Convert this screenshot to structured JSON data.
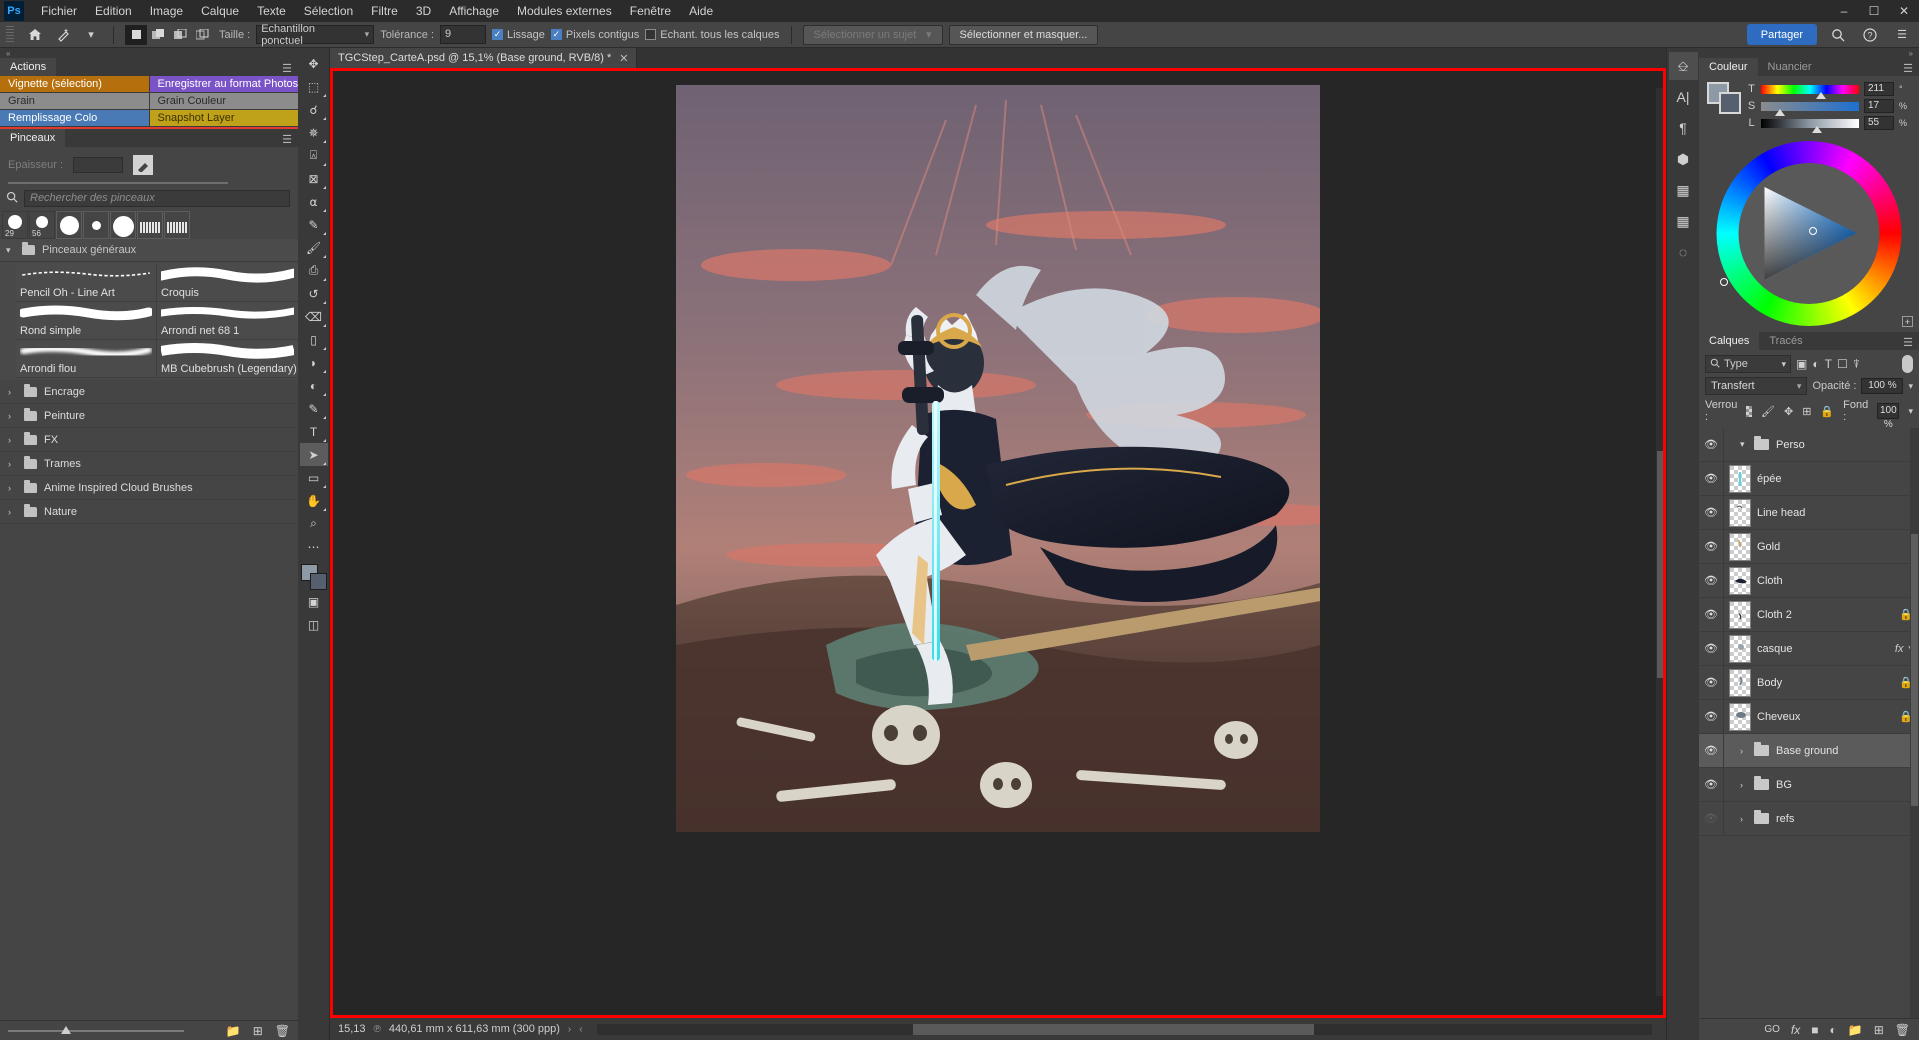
{
  "menubar": {
    "logo": "Ps",
    "items": [
      "Fichier",
      "Edition",
      "Image",
      "Calque",
      "Texte",
      "Sélection",
      "Filtre",
      "3D",
      "Affichage",
      "Modules externes",
      "Fenêtre",
      "Aide"
    ],
    "window_controls": [
      "minimize",
      "maximize",
      "close"
    ]
  },
  "options_bar": {
    "home_icon": "home-icon",
    "tool_icon": "magic-wand-icon",
    "selection_modes": [
      "new-selection",
      "add-to-selection",
      "subtract-from-selection",
      "intersect-selection"
    ],
    "size_label": "Taille :",
    "size_value": "Echantillon ponctuel",
    "tolerance_label": "Tolérance :",
    "tolerance_value": "9",
    "smoothing_label": "Lissage",
    "smoothing_checked": true,
    "contiguous_label": "Pixels contigus",
    "contiguous_checked": true,
    "all_layers_label": "Echant. tous les calques",
    "all_layers_checked": false,
    "select_subject_label": "Sélectionner un sujet",
    "select_mask_label": "Sélectionner et masquer...",
    "share_label": "Partager",
    "search_icon": "search-icon",
    "help_icon": "help-icon",
    "grid_icon": "grid-icon",
    "accent_color": "#2d6cc0"
  },
  "left_dock": {
    "actions_panel": {
      "tab_label": "Actions",
      "tab_inactive": "",
      "buttons": [
        [
          {
            "label": "Vignette (sélection)",
            "color": "#b5700d",
            "text_color": "#ffffff"
          },
          {
            "label": "Enregistrer au format Photos...",
            "color": "#7a54c6",
            "text_color": "#ffffff"
          }
        ],
        [
          {
            "label": "Grain",
            "color": "#8c8c8c",
            "text_color": "#2b2b2b"
          },
          {
            "label": "Grain Couleur",
            "color": "#8c8c8c",
            "text_color": "#2b2b2b"
          }
        ],
        [
          {
            "label": "Remplissage Colo",
            "color": "#4a7ab5",
            "text_color": "#ffffff"
          },
          {
            "label": "Snapshot Layer",
            "color": "#c0a21a",
            "text_color": "#3a3000"
          }
        ]
      ],
      "divider_color": "#e03a32"
    },
    "brushes_panel": {
      "tab_label": "Pinceaux",
      "thickness_label": "Epaisseur :",
      "thickness_value": "",
      "search_placeholder": "Rechercher des pinceaux",
      "presets": [
        {
          "name": "29",
          "size": 14
        },
        {
          "name": "56",
          "size": 12
        },
        {
          "name": "",
          "size": 20
        },
        {
          "name": "",
          "size": 9
        },
        {
          "name": "",
          "size": 21
        },
        {
          "name": "",
          "size": 0
        },
        {
          "name": "",
          "size": 0
        }
      ],
      "group_label": "Pinceaux généraux",
      "brushes": [
        {
          "label": "Pencil Oh - Line Art",
          "style": "pencil"
        },
        {
          "label": "Croquis",
          "style": "thick"
        },
        {
          "label": "Rond simple",
          "style": "round"
        },
        {
          "label": "Arrondi net 68 1",
          "style": "thin"
        },
        {
          "label": "Arrondi flou",
          "style": "soft"
        },
        {
          "label": "MB Cubebrush (Legendary)",
          "style": "thick"
        }
      ],
      "folders": [
        "Encrage",
        "Peinture",
        "FX",
        "Trames",
        "Anime Inspired Cloud Brushes",
        "Nature"
      ],
      "footer_icons": [
        "new-folder-icon",
        "new-brush-icon",
        "delete-icon"
      ]
    }
  },
  "toolbar": {
    "tools": [
      {
        "name": "move-tool",
        "glyph": "✥",
        "selected": false
      },
      {
        "name": "marquee-tool",
        "glyph": "⬚",
        "selected": false
      },
      {
        "name": "lasso-tool",
        "glyph": "◠",
        "selected": false
      },
      {
        "name": "magic-wand-tool",
        "glyph": "✧",
        "selected": false
      },
      {
        "name": "crop-tool",
        "glyph": "⌗",
        "selected": false
      },
      {
        "name": "frame-tool",
        "glyph": "⊠",
        "selected": false
      },
      {
        "name": "eyedropper-tool",
        "glyph": "⌁",
        "selected": false
      },
      {
        "name": "healing-brush-tool",
        "glyph": "✎",
        "selected": false
      },
      {
        "name": "brush-tool",
        "glyph": "🖌",
        "selected": false
      },
      {
        "name": "clone-stamp-tool",
        "glyph": "⎙",
        "selected": false
      },
      {
        "name": "history-brush-tool",
        "glyph": "↺",
        "selected": false
      },
      {
        "name": "eraser-tool",
        "glyph": "⌫",
        "selected": false
      },
      {
        "name": "gradient-tool",
        "glyph": "▭",
        "selected": false
      },
      {
        "name": "blur-tool",
        "glyph": "◗",
        "selected": false
      },
      {
        "name": "dodge-tool",
        "glyph": "◐",
        "selected": false
      },
      {
        "name": "pen-tool",
        "glyph": "✒",
        "selected": false
      },
      {
        "name": "type-tool",
        "glyph": "T",
        "selected": false
      },
      {
        "name": "path-selection-tool",
        "glyph": "➤",
        "selected": true
      },
      {
        "name": "rectangle-tool",
        "glyph": "▭",
        "selected": false
      },
      {
        "name": "hand-tool",
        "glyph": "✋",
        "selected": false
      },
      {
        "name": "zoom-tool",
        "glyph": "⌕",
        "selected": false
      },
      {
        "name": "more-tools",
        "glyph": "•••",
        "selected": false
      }
    ],
    "foreground_color": "#8e99a6",
    "background_color": "#555f6d",
    "quick_mask_icon": "quick-mask-icon",
    "screen_mode_icon": "screen-mode-icon"
  },
  "document": {
    "tab_title": "TGCStep_CarteA.psd @ 15,1% (Base ground, RVB/8) *",
    "close_glyph": "✕",
    "selection_border_color": "#ff0000"
  },
  "statusbar": {
    "zoom": "15,13",
    "zoom_unit": "%",
    "doc_size": "440,61 mm x 611,63 mm (300 ppp)",
    "arrow_right": "›",
    "arrow_left": "‹"
  },
  "icon_rail": {
    "buttons": [
      {
        "name": "properties-icon",
        "glyph": "⌸",
        "active": true
      },
      {
        "name": "character-icon",
        "glyph": "A",
        "active": false
      },
      {
        "name": "paragraph-icon",
        "glyph": "¶",
        "active": false
      },
      {
        "name": "3d-icon",
        "glyph": "⬡",
        "active": false
      },
      {
        "name": "library-icon",
        "glyph": "▤",
        "active": false
      },
      {
        "name": "histogram-icon",
        "glyph": "▦",
        "active": false
      },
      {
        "name": "adjustments-icon",
        "glyph": "◍",
        "active": false
      }
    ]
  },
  "right_dock": {
    "color_panel": {
      "tabs": [
        {
          "label": "Couleur",
          "active": true
        },
        {
          "label": "Nuancier",
          "active": false
        }
      ],
      "menu_icon": "panel-menu-icon",
      "foreground_color": "#8e99a6",
      "background_color": "#555f6d",
      "sliders": [
        {
          "label": "T",
          "value": "211",
          "unit": "°",
          "pos": 60
        },
        {
          "label": "S",
          "value": "17",
          "unit": "%",
          "pos": 17
        },
        {
          "label": "L",
          "value": "55",
          "unit": "%",
          "pos": 55
        }
      ],
      "add_swatch_icon": "add-swatch-icon"
    },
    "layers_panel": {
      "tabs": [
        {
          "label": "Calques",
          "active": true
        },
        {
          "label": "Tracés",
          "active": false
        }
      ],
      "menu_icon": "panel-menu-icon",
      "filter_label": "Type",
      "filter_icons": [
        "pixel-filter-icon",
        "adjustment-filter-icon",
        "type-filter-icon",
        "shape-filter-icon",
        "smart-object-filter-icon"
      ],
      "blend_mode": "Transfert",
      "opacity_label": "Opacité :",
      "opacity_value": "100 %",
      "lock_label": "Verrou :",
      "lock_icons": [
        "lock-transparent-icon",
        "lock-image-icon",
        "lock-position-icon",
        "lock-artboard-icon",
        "lock-all-icon"
      ],
      "fill_label": "Fond :",
      "fill_value": "100 %",
      "layers": [
        {
          "name": "Perso",
          "type": "group",
          "expanded": true,
          "visible": true,
          "locked": false,
          "fx": false,
          "selected": false
        },
        {
          "name": "épée",
          "type": "layer",
          "visible": true,
          "locked": false,
          "fx": false,
          "selected": false
        },
        {
          "name": "Line head",
          "type": "layer",
          "visible": true,
          "locked": false,
          "fx": false,
          "selected": false
        },
        {
          "name": "Gold",
          "type": "layer",
          "visible": true,
          "locked": false,
          "fx": false,
          "selected": false
        },
        {
          "name": "Cloth",
          "type": "layer",
          "visible": true,
          "locked": false,
          "fx": false,
          "selected": false
        },
        {
          "name": "Cloth 2",
          "type": "layer",
          "visible": true,
          "locked": true,
          "fx": false,
          "selected": false
        },
        {
          "name": "casque",
          "type": "layer",
          "visible": true,
          "locked": false,
          "fx": true,
          "selected": false
        },
        {
          "name": "Body",
          "type": "layer",
          "visible": true,
          "locked": true,
          "fx": false,
          "selected": false
        },
        {
          "name": "Cheveux",
          "type": "layer",
          "visible": true,
          "locked": true,
          "fx": false,
          "selected": false
        },
        {
          "name": "Base ground",
          "type": "group",
          "expanded": false,
          "visible": true,
          "locked": false,
          "fx": false,
          "selected": true
        },
        {
          "name": "BG",
          "type": "group",
          "expanded": false,
          "visible": true,
          "locked": false,
          "fx": false,
          "selected": false
        },
        {
          "name": "refs",
          "type": "group",
          "expanded": false,
          "visible": false,
          "locked": false,
          "fx": false,
          "selected": false
        }
      ],
      "footer_icons": [
        "link-layers-icon",
        "layer-style-icon",
        "layer-mask-icon",
        "adjustment-layer-icon",
        "new-group-icon",
        "new-layer-icon",
        "delete-layer-icon"
      ],
      "footer_first_label": "GO"
    }
  }
}
